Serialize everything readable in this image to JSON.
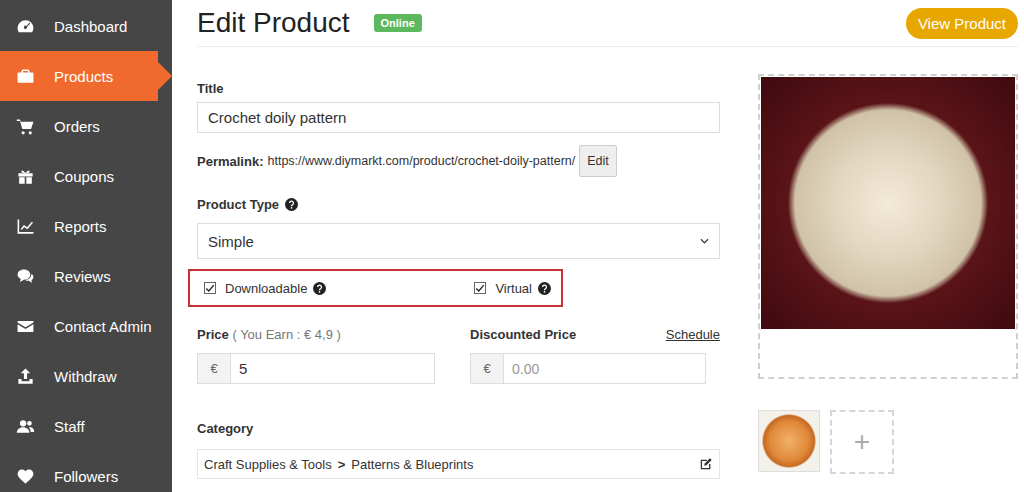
{
  "sidebar": {
    "items": [
      {
        "label": "Dashboard",
        "selected": false
      },
      {
        "label": "Products",
        "selected": true
      },
      {
        "label": "Orders",
        "selected": false
      },
      {
        "label": "Coupons",
        "selected": false
      },
      {
        "label": "Reports",
        "selected": false
      },
      {
        "label": "Reviews",
        "selected": false
      },
      {
        "label": "Contact Admin",
        "selected": false
      },
      {
        "label": "Withdraw",
        "selected": false
      },
      {
        "label": "Staff",
        "selected": false
      },
      {
        "label": "Followers",
        "selected": false
      }
    ]
  },
  "header": {
    "title": "Edit Product",
    "status": "Online",
    "view_button": "View Product"
  },
  "form": {
    "title": {
      "label": "Title",
      "value": "Crochet doily pattern"
    },
    "permalink": {
      "label": "Permalink:",
      "url": "https://www.diymarkt.com/product/crochet-doily-pattern/",
      "button": "Edit"
    },
    "product_type": {
      "label": "Product Type",
      "value": "Simple"
    },
    "options": [
      {
        "label": "Downloadable",
        "checked": true
      },
      {
        "label": "Virtual",
        "checked": true
      }
    ],
    "price": {
      "label": "Price",
      "earn": "( You Earn : € 4,9 )",
      "currency": "€",
      "value": "5"
    },
    "discounted_price": {
      "label": "Discounted Price",
      "schedule": "Schedule",
      "currency": "€",
      "placeholder": "0.00"
    },
    "category": {
      "label": "Category",
      "path": [
        "Craft Supplies & Tools",
        "Patterns & Blueprints"
      ],
      "separator": ">"
    }
  },
  "media": {
    "add_button": "+"
  }
}
